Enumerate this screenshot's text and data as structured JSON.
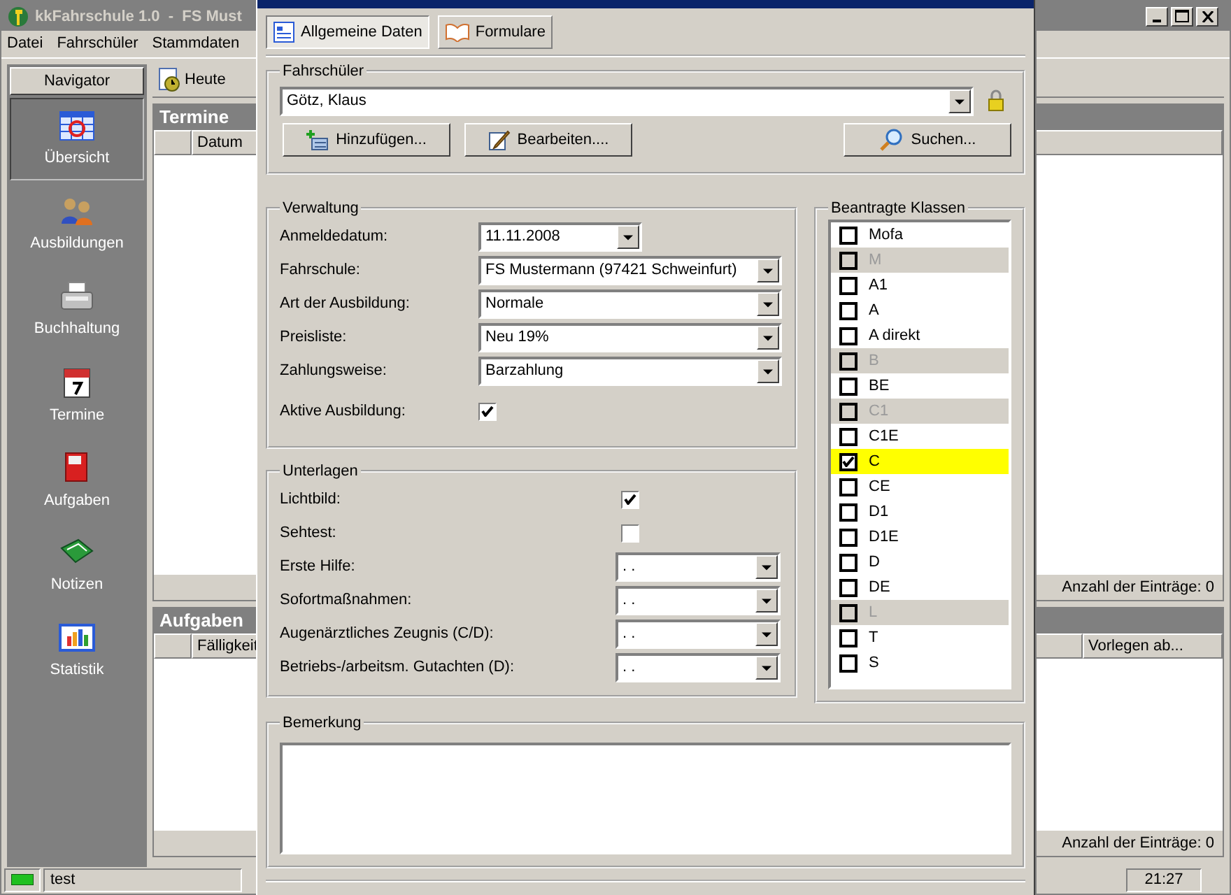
{
  "main_window": {
    "title": "kkFahrschule 1.0  -  FS Must",
    "menu": [
      "Datei",
      "Fahrschüler",
      "Stammdaten"
    ]
  },
  "navigator": {
    "title": "Navigator",
    "items": [
      {
        "label": "Übersicht",
        "selected": true
      },
      {
        "label": "Ausbildungen",
        "selected": false
      },
      {
        "label": "Buchhaltung",
        "selected": false
      },
      {
        "label": "Termine",
        "selected": false
      },
      {
        "label": "Aufgaben",
        "selected": false
      },
      {
        "label": "Notizen",
        "selected": false
      },
      {
        "label": "Statistik",
        "selected": false
      }
    ]
  },
  "toolbar": {
    "button": "Heute"
  },
  "termine": {
    "title": "Termine",
    "columns": [
      "Datum"
    ],
    "count": "Anzahl der Einträge: 0"
  },
  "aufgaben": {
    "title": "Aufgaben",
    "columns": [
      "Fälligkeit",
      "Vorlegen ab..."
    ],
    "count": "Anzahl der Einträge: 0"
  },
  "status_bar": {
    "text": "test",
    "time": "21:27"
  },
  "dialog": {
    "tabs": [
      {
        "label": "Allgemeine Daten",
        "selected": true
      },
      {
        "label": "Formulare",
        "selected": false
      }
    ],
    "student": {
      "legend": "Fahrschüler",
      "value": "Götz, Klaus",
      "buttons": [
        "Hinzufügen...",
        "Bearbeiten....",
        "Suchen..."
      ]
    },
    "verwaltung": {
      "legend": "Verwaltung",
      "fields": [
        {
          "kind": "date",
          "label": "Anmeldedatum:",
          "value": "11.11.2008"
        },
        {
          "kind": "select",
          "label": "Fahrschule:",
          "value": "FS Mustermann (97421 Schweinfurt)"
        },
        {
          "kind": "select",
          "label": "Art der Ausbildung:",
          "value": "Normale"
        },
        {
          "kind": "select",
          "label": "Preisliste:",
          "value": "Neu 19%"
        },
        {
          "kind": "select",
          "label": "Zahlungsweise:",
          "value": "Barzahlung"
        },
        {
          "kind": "checkbox",
          "label": "Aktive Ausbildung:",
          "checked": true
        }
      ]
    },
    "unterlagen": {
      "legend": "Unterlagen",
      "fields": [
        {
          "kind": "checkbox",
          "label": "Lichtbild:",
          "checked": true
        },
        {
          "kind": "checkbox",
          "label": "Sehtest:",
          "checked": false
        },
        {
          "kind": "date",
          "label": "Erste Hilfe:",
          "value": ". ."
        },
        {
          "kind": "date",
          "label": "Sofortmaßnahmen:",
          "value": ". ."
        },
        {
          "kind": "date",
          "label": "Augenärztliches Zeugnis (C/D):",
          "value": ". ."
        },
        {
          "kind": "date",
          "label": "Betriebs-/arbeitsm. Gutachten (D):",
          "value": ". ."
        }
      ]
    },
    "klassen": {
      "legend": "Beantragte Klassen",
      "items": [
        {
          "label": "Mofa",
          "checked": false,
          "disabled": false,
          "selected": false
        },
        {
          "label": "M",
          "checked": false,
          "disabled": true,
          "selected": false
        },
        {
          "label": "A1",
          "checked": false,
          "disabled": false,
          "selected": false
        },
        {
          "label": "A",
          "checked": false,
          "disabled": false,
          "selected": false
        },
        {
          "label": "A direkt",
          "checked": false,
          "disabled": false,
          "selected": false
        },
        {
          "label": "B",
          "checked": false,
          "disabled": true,
          "selected": false
        },
        {
          "label": "BE",
          "checked": false,
          "disabled": false,
          "selected": false
        },
        {
          "label": "C1",
          "checked": false,
          "disabled": true,
          "selected": false
        },
        {
          "label": "C1E",
          "checked": false,
          "disabled": false,
          "selected": false
        },
        {
          "label": "C",
          "checked": true,
          "disabled": false,
          "selected": true
        },
        {
          "label": "CE",
          "checked": false,
          "disabled": false,
          "selected": false
        },
        {
          "label": "D1",
          "checked": false,
          "disabled": false,
          "selected": false
        },
        {
          "label": "D1E",
          "checked": false,
          "disabled": false,
          "selected": false
        },
        {
          "label": "D",
          "checked": false,
          "disabled": false,
          "selected": false
        },
        {
          "label": "DE",
          "checked": false,
          "disabled": false,
          "selected": false
        },
        {
          "label": "L",
          "checked": false,
          "disabled": true,
          "selected": false
        },
        {
          "label": "T",
          "checked": false,
          "disabled": false,
          "selected": false
        },
        {
          "label": "S",
          "checked": false,
          "disabled": false,
          "selected": false
        }
      ]
    },
    "bemerkung": {
      "legend": "Bemerkung"
    }
  }
}
